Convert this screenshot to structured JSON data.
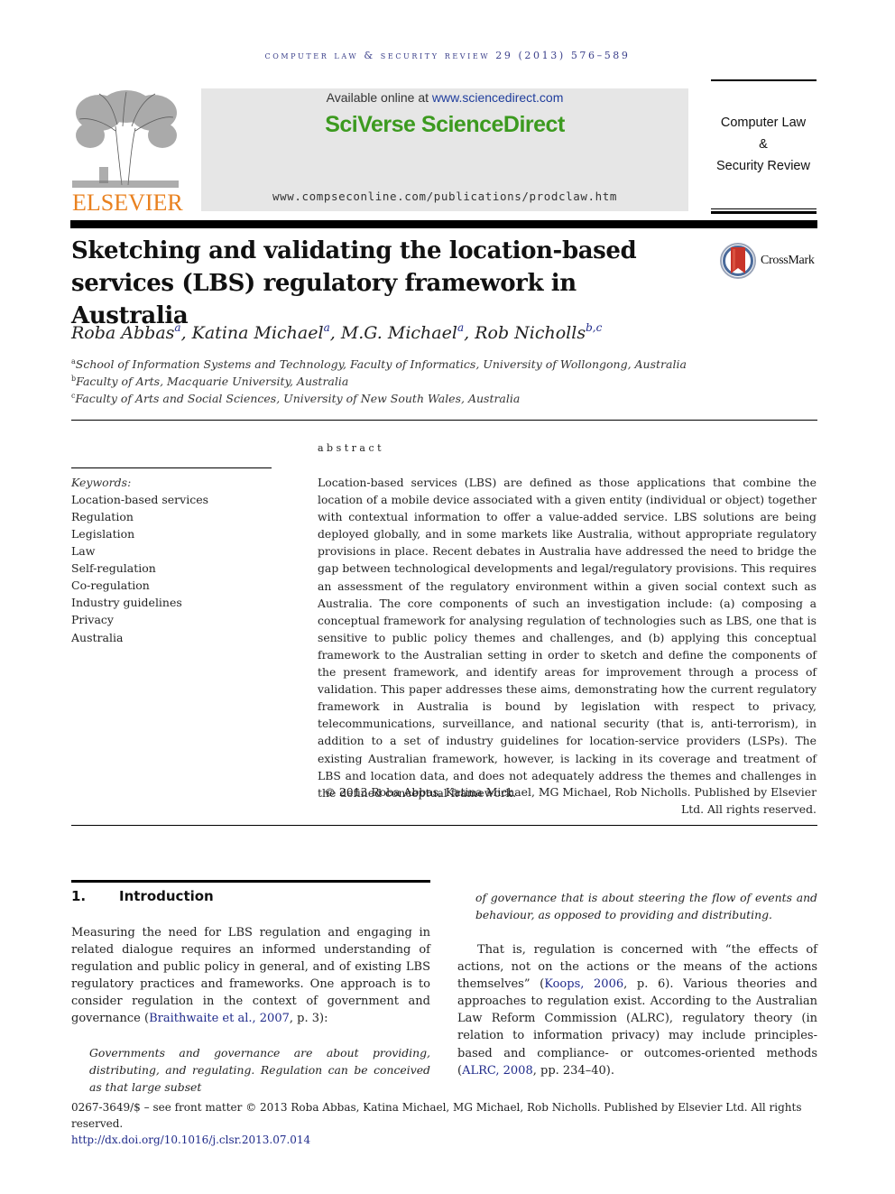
{
  "header": {
    "journal_line": "computer law & security review 29 (2013) 576–589",
    "publisher_wordmark": "ELSEVIER",
    "available_online_prefix": "Available online at ",
    "available_online_link": "www.sciencedirect.com",
    "platform_brand": "SciVerse ScienceDirect",
    "journal_url": "www.compseconline.com/publications/prodclaw.htm",
    "journal_title_lines": [
      "Computer Law",
      "&",
      "Security Review"
    ],
    "colors": {
      "elsevier_orange": "#e9811f",
      "sciencedirect_green": "#3c9a1f",
      "link_blue": "#1f2a8a"
    }
  },
  "article": {
    "title_lines": [
      "Sketching and validating the location-based",
      "services (LBS) regulatory framework in Australia"
    ],
    "crossmark_label": "CrossMark",
    "authors": [
      {
        "name": "Roba Abbas",
        "affil": "a"
      },
      {
        "name": "Katina Michael",
        "affil": "a"
      },
      {
        "name": "M.G. Michael",
        "affil": "a"
      },
      {
        "name": "Rob Nicholls",
        "affil": "b,c"
      }
    ],
    "affiliations": [
      {
        "key": "a",
        "text": "School of Information Systems and Technology, Faculty of Informatics, University of Wollongong, Australia"
      },
      {
        "key": "b",
        "text": "Faculty of Arts, Macquarie University, Australia"
      },
      {
        "key": "c",
        "text": "Faculty of Arts and Social Sciences, University of New South Wales, Australia"
      }
    ]
  },
  "keywords": {
    "heading": "Keywords:",
    "items": [
      "Location-based services",
      "Regulation",
      "Legislation",
      "Law",
      "Self-regulation",
      "Co-regulation",
      "Industry guidelines",
      "Privacy",
      "Australia"
    ]
  },
  "abstract": {
    "heading": "abstract",
    "text": "Location-based services (LBS) are defined as those applications that combine the location of a mobile device associated with a given entity (individual or object) together with contextual information to offer a value-added service. LBS solutions are being deployed globally, and in some markets like Australia, without appropriate regulatory provisions in place. Recent debates in Australia have addressed the need to bridge the gap between technological developments and legal/regulatory provisions. This requires an assessment of the regulatory environment within a given social context such as Australia. The core components of such an investigation include: (a) composing a conceptual framework for analysing regulation of technologies such as LBS, one that is sensitive to public policy themes and challenges, and (b) applying this conceptual framework to the Australian setting in order to sketch and define the components of the present framework, and identify areas for improvement through a process of validation. This paper addresses these aims, demonstrating how the current regulatory framework in Australia is bound by legislation with respect to privacy, telecommunications, surveillance, and national security (that is, anti-terrorism), in addition to a set of industry guidelines for location-service providers (LSPs). The existing Australian framework, however, is lacking in its coverage and treatment of LBS and location data, and does not adequately address the themes and challenges in the defined conceptual framework.",
    "copyright": "© 2013 Roba Abbas, Katina Michael, MG Michael, Rob Nicholls. Published by Elsevier Ltd. All rights reserved."
  },
  "section1": {
    "number": "1.",
    "title": "Introduction",
    "para1_text": "Measuring the need for LBS regulation and engaging in related dialogue requires an informed understanding of regulation and public policy in general, and of existing LBS regulatory practices and frameworks. One approach is to consider regulation in the context of government and governance (",
    "para1_cite": "Braithwaite et al., 2007",
    "para1_tail": ", p. 3):",
    "quote_col1": "Governments and governance are about providing, distributing, and regulating. Regulation can be conceived as that large subset",
    "quote_col2": "of governance that is about steering the flow of events and behaviour, as opposed to providing and distributing.",
    "para2_a": "That is, regulation is concerned with “the effects of actions, not on the actions or the means of the actions themselves” (",
    "para2_cite1": "Koops, 2006",
    "para2_b": ", p. 6). Various theories and approaches to regulation exist. According to the Australian Law Reform Commission (ALRC), regulatory theory (in relation to information privacy) may include principles-based and compliance- or outcomes-oriented methods (",
    "para2_cite2": "ALRC, 2008",
    "para2_c": ", pp. 234–40)."
  },
  "footer": {
    "front_matter": "0267-3649/$ – see front matter © 2013 Roba Abbas, Katina Michael, MG Michael, Rob Nicholls. Published by Elsevier Ltd. All rights reserved.",
    "doi": "http://dx.doi.org/10.1016/j.clsr.2013.07.014"
  }
}
